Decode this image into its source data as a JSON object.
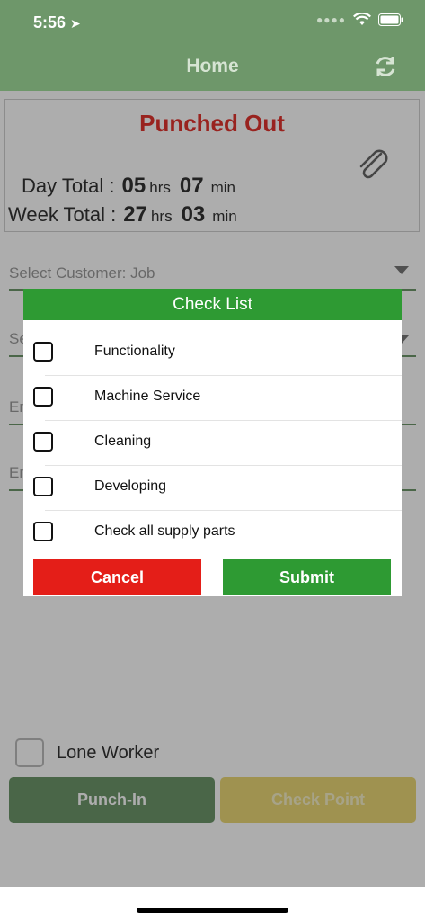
{
  "status": {
    "time": "5:56"
  },
  "nav": {
    "title": "Home"
  },
  "punch": {
    "state": "Punched Out",
    "day_label": "Day Total :",
    "day_hrs": "05",
    "day_min": "07",
    "week_label": "Week Total :",
    "week_hrs": "27",
    "week_min": "03",
    "hrs_unit": "hrs",
    "min_unit": "min"
  },
  "form": {
    "customer_placeholder": "Select Customer: Job",
    "field2_placeholder": "Se",
    "field3_placeholder": "En",
    "field4_placeholder": "En"
  },
  "lone_worker": {
    "label": "Lone Worker",
    "checked": false
  },
  "actions": {
    "punch_in": "Punch-In",
    "check_point": "Check Point"
  },
  "dialog": {
    "title": "Check List",
    "items": [
      {
        "label": "Functionality",
        "checked": false
      },
      {
        "label": "Machine Service",
        "checked": false
      },
      {
        "label": "Cleaning",
        "checked": false
      },
      {
        "label": "Developing",
        "checked": false
      },
      {
        "label": "Check all supply parts",
        "checked": false
      }
    ],
    "cancel": "Cancel",
    "submit": "Submit"
  },
  "colors": {
    "header": "#6e976a",
    "accent_green": "#2e9a33",
    "cancel_red": "#e41e18",
    "punched_out_red": "#e2342f",
    "checkpoint_yellow": "#ead776"
  }
}
